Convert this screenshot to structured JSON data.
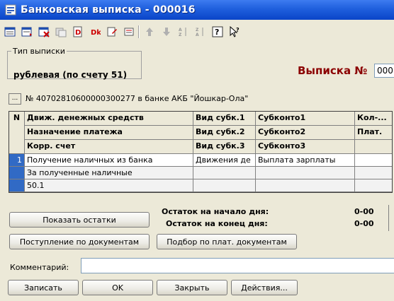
{
  "window": {
    "title": "Банковская выписка - 000016"
  },
  "statement_type": {
    "legend": "Тип выписки",
    "value": "рублевая (по счету 51)"
  },
  "statement_number": {
    "label": "Выписка №",
    "value": "000"
  },
  "account": {
    "button_label": "...",
    "text": "№ 40702810600000300277 в банке АКБ \"Йошкар-Ола\""
  },
  "grid": {
    "header": {
      "n": "N",
      "col1": [
        "Движ. денежных средств",
        "Назначение платежа",
        "Корр. счет"
      ],
      "col2": [
        "Вид субк.1",
        "Вид субк.2",
        "Вид субк.3"
      ],
      "col3": [
        "Субконто1",
        "Субконто2",
        "Субконто3"
      ],
      "col4": [
        "Кол-...",
        "Плат."
      ]
    },
    "rows": [
      {
        "n": "1",
        "col1": [
          "Получение наличных из банка",
          "За полученные наличные",
          "50.1"
        ],
        "col2": [
          "Движения де",
          "",
          ""
        ],
        "col3": [
          "Выплата зарплаты",
          "",
          ""
        ],
        "col4": [
          "",
          "",
          ""
        ]
      }
    ]
  },
  "buttons": {
    "show_balances": "Показать остатки",
    "receipt_by_docs": "Поступление по документам",
    "select_by_payment_docs": "Подбор по плат. документам",
    "save": "Записать",
    "ok": "OK",
    "close": "Закрыть",
    "actions": "Действия..."
  },
  "balances": {
    "start_label": "Остаток на начало дня:",
    "start_value": "0-00",
    "end_label": "Остаток на конец дня:",
    "end_value": "0-00"
  },
  "comment": {
    "label": "Комментарий:",
    "value": ""
  },
  "icons": {
    "toolbar": [
      "new-row-icon",
      "insert-row-icon",
      "delete-row-icon",
      "copy-row-icon",
      "debit-icon",
      "credit-icon",
      "edit-doc-icon",
      "settings-icon",
      "move-up-icon",
      "move-down-icon",
      "sort-asc-icon",
      "sort-desc-icon",
      "help-icon",
      "context-help-icon"
    ]
  },
  "colors": {
    "titlebar": "#0a45c8",
    "statement_label": "#8b0000",
    "selection": "#316ac5"
  }
}
